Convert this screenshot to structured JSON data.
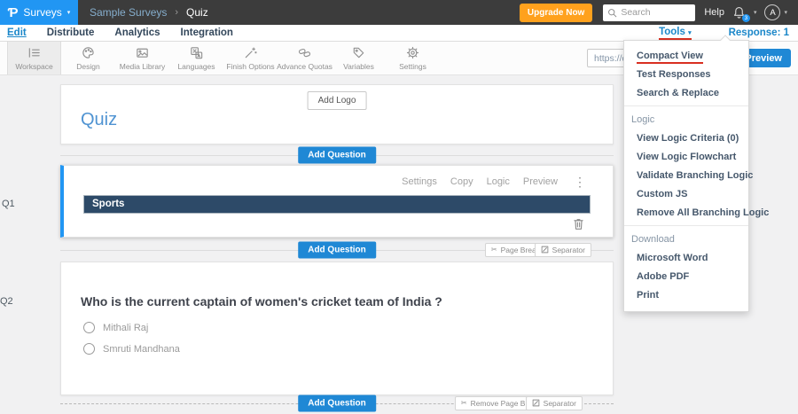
{
  "topbar": {
    "logo_glyph": "Ƥ",
    "product_label": "Surveys",
    "breadcrumb": {
      "parent": "Sample Surveys",
      "separator": "›",
      "current": "Quiz"
    },
    "upgrade_button": "Upgrade Now",
    "search_placeholder": "Search",
    "help_label": "Help",
    "notification_badge": "3",
    "avatar_initial": "A"
  },
  "nav": {
    "items": [
      "Edit",
      "Distribute",
      "Analytics",
      "Integration"
    ],
    "active_item": "Edit",
    "tools_label": "Tools",
    "response_label": "Response: 1"
  },
  "toolbar": {
    "items": [
      {
        "label": "Workspace",
        "icon": "workspace-list-icon",
        "active": true
      },
      {
        "label": "Design",
        "icon": "palette-icon"
      },
      {
        "label": "Media Library",
        "icon": "image-icon"
      },
      {
        "label": "Languages",
        "icon": "translate-icon"
      },
      {
        "label": "Finish Options",
        "icon": "wand-icon"
      },
      {
        "label": "Advance Quotas",
        "icon": "chain-links-icon"
      },
      {
        "label": "Variables",
        "icon": "tag-icon"
      },
      {
        "label": "Settings",
        "icon": "gear-icon"
      }
    ],
    "url_value": "https://q",
    "preview_label": "Preview"
  },
  "tools_menu": {
    "active_item": "Compact View",
    "items_top": [
      "Compact View",
      "Test Responses",
      "Search & Replace"
    ],
    "sections": [
      {
        "title": "Logic",
        "items": [
          "View Logic Criteria (0)",
          "View Logic Flowchart",
          "Validate Branching Logic",
          "Custom JS",
          "Remove All Branching Logic"
        ]
      },
      {
        "title": "Download",
        "items": [
          "Microsoft Word",
          "Adobe PDF",
          "Print"
        ]
      }
    ]
  },
  "canvas": {
    "add_logo_label": "Add Logo",
    "survey_title": "Quiz",
    "add_question_label": "Add Question",
    "page_break_label": "Page Break",
    "separator_label": "Separator",
    "remove_page_break_label": "Remove Page Break",
    "q1": {
      "id_label": "Q1",
      "actions": [
        "Settings",
        "Copy",
        "Logic",
        "Preview"
      ],
      "group_header": "Sports"
    },
    "q2": {
      "id_label": "Q2",
      "question": "Who is the current captain of women's cricket team of India ?",
      "options": [
        "Mithali Raj",
        "Smruti Mandhana"
      ]
    }
  },
  "icons": {
    "caret_down": "▾",
    "kebab": "⋮",
    "scissors": "✂"
  },
  "colors": {
    "accent_blue": "#1f88d5",
    "logo_blue": "#2196f3",
    "upgrade_orange": "#ffa11d",
    "underline_red": "#d92f21",
    "group_header_navy": "#2d4a68",
    "topbar_gray": "#3c3c3c"
  }
}
